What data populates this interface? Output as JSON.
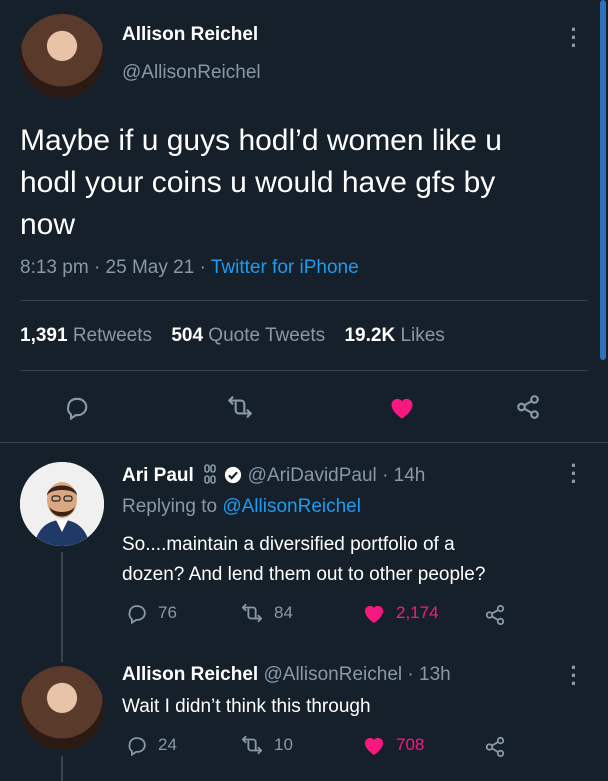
{
  "main_tweet": {
    "author_name": "Allison Reichel",
    "author_handle": "@AllisonReichel",
    "text_line1": "Maybe if u guys hodl’d women like u",
    "text_line2": "hodl your coins u would have gfs by",
    "text_line3": "now",
    "time": "8:13 pm",
    "date": "25 May 21",
    "source": "Twitter for iPhone",
    "sep": "·",
    "retweets_count": "1,391",
    "retweets_label": "Retweets",
    "quotes_count": "504",
    "quotes_label": "Quote Tweets",
    "likes_count": "19.2K",
    "likes_label": "Likes"
  },
  "reply1": {
    "author_name": "Ari Paul",
    "author_handle": "@AriDavidPaul",
    "sep": "·",
    "time": "14h",
    "replying_prefix": "Replying to",
    "replying_to": "@AllisonReichel",
    "text_line1": "So....maintain a diversified portfolio of a",
    "text_line2": "dozen? And lend them out to other people?",
    "reply_count": "76",
    "retweet_count": "84",
    "like_count": "2,174"
  },
  "reply2": {
    "author_name": "Allison Reichel",
    "author_handle": "@AllisonReichel",
    "sep": "·",
    "time": "13h",
    "text": "Wait I didn’t think this through",
    "reply_count": "24",
    "retweet_count": "10",
    "like_count": "708"
  },
  "colors": {
    "background": "#15202b",
    "muted": "#8899a6",
    "link": "#1d9bf0",
    "like": "#f91880"
  }
}
